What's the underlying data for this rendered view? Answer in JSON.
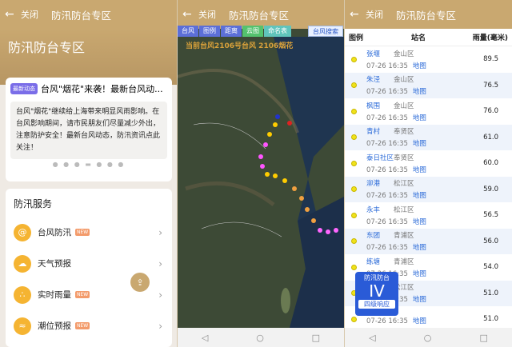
{
  "header": {
    "back_icon": "arrow-left-icon",
    "close_label": "关闭",
    "title": "防汛防台专区"
  },
  "home": {
    "hero_title": "防汛防台专区",
    "news": {
      "badge": "最新动态",
      "headline": "台风\"烟花\"来袭！最新台风动...",
      "body": "台风\"烟花\"继续给上海带来明显风雨影响。在台风影响期间，请市民朋友们尽量减少外出，注意防护安全！最新台风动态，防汛资讯点此关注！"
    },
    "services_title": "防汛服务",
    "services": [
      {
        "label": "台风防汛",
        "new": "NEW",
        "icon": "typhoon-icon"
      },
      {
        "label": "天气预报",
        "new": "",
        "icon": "weather-icon"
      },
      {
        "label": "实时雨量",
        "new": "NEW",
        "icon": "rain-icon"
      },
      {
        "label": "潮位预报",
        "new": "NEW",
        "icon": "tide-icon"
      }
    ],
    "share_icon": "share-icon"
  },
  "map": {
    "tabs": [
      "台风",
      "图例",
      "距离",
      "云图",
      "命名表"
    ],
    "search_label": "台风搜索",
    "overlay": "当前台风2106号台风 2106烟花"
  },
  "rain": {
    "columns": [
      "图例",
      "站名",
      "雨量(毫米)"
    ],
    "map_link": "地图",
    "rows": [
      {
        "station": "张堰",
        "district": "金山区",
        "time": "07-26 16:35",
        "value": "89.5"
      },
      {
        "station": "朱泾",
        "district": "金山区",
        "time": "07-26 16:35",
        "value": "76.5"
      },
      {
        "station": "枫围",
        "district": "金山区",
        "time": "07-26 16:35",
        "value": "76.0"
      },
      {
        "station": "青村",
        "district": "奉贤区",
        "time": "07-26 16:35",
        "value": "61.0"
      },
      {
        "station": "泰日社区",
        "district": "奉贤区",
        "time": "07-26 16:35",
        "value": "60.0"
      },
      {
        "station": "泖港",
        "district": "松江区",
        "time": "07-26 16:35",
        "value": "59.0"
      },
      {
        "station": "永丰",
        "district": "松江区",
        "time": "07-26 16:35",
        "value": "56.5"
      },
      {
        "station": "东团",
        "district": "青浦区",
        "time": "07-26 16:35",
        "value": "56.0"
      },
      {
        "station": "练塘",
        "district": "青浦区",
        "time": "07-26 16:35",
        "value": "54.0"
      },
      {
        "station": "",
        "district": "松江区",
        "time": "07-26 16:35",
        "value": "51.0"
      },
      {
        "station": "",
        "district": "",
        "time": "07-26 16:35",
        "value": "51.0"
      }
    ]
  },
  "level_badge": {
    "top": "防汛防台",
    "level": "IV",
    "bottom": "四级响应"
  }
}
